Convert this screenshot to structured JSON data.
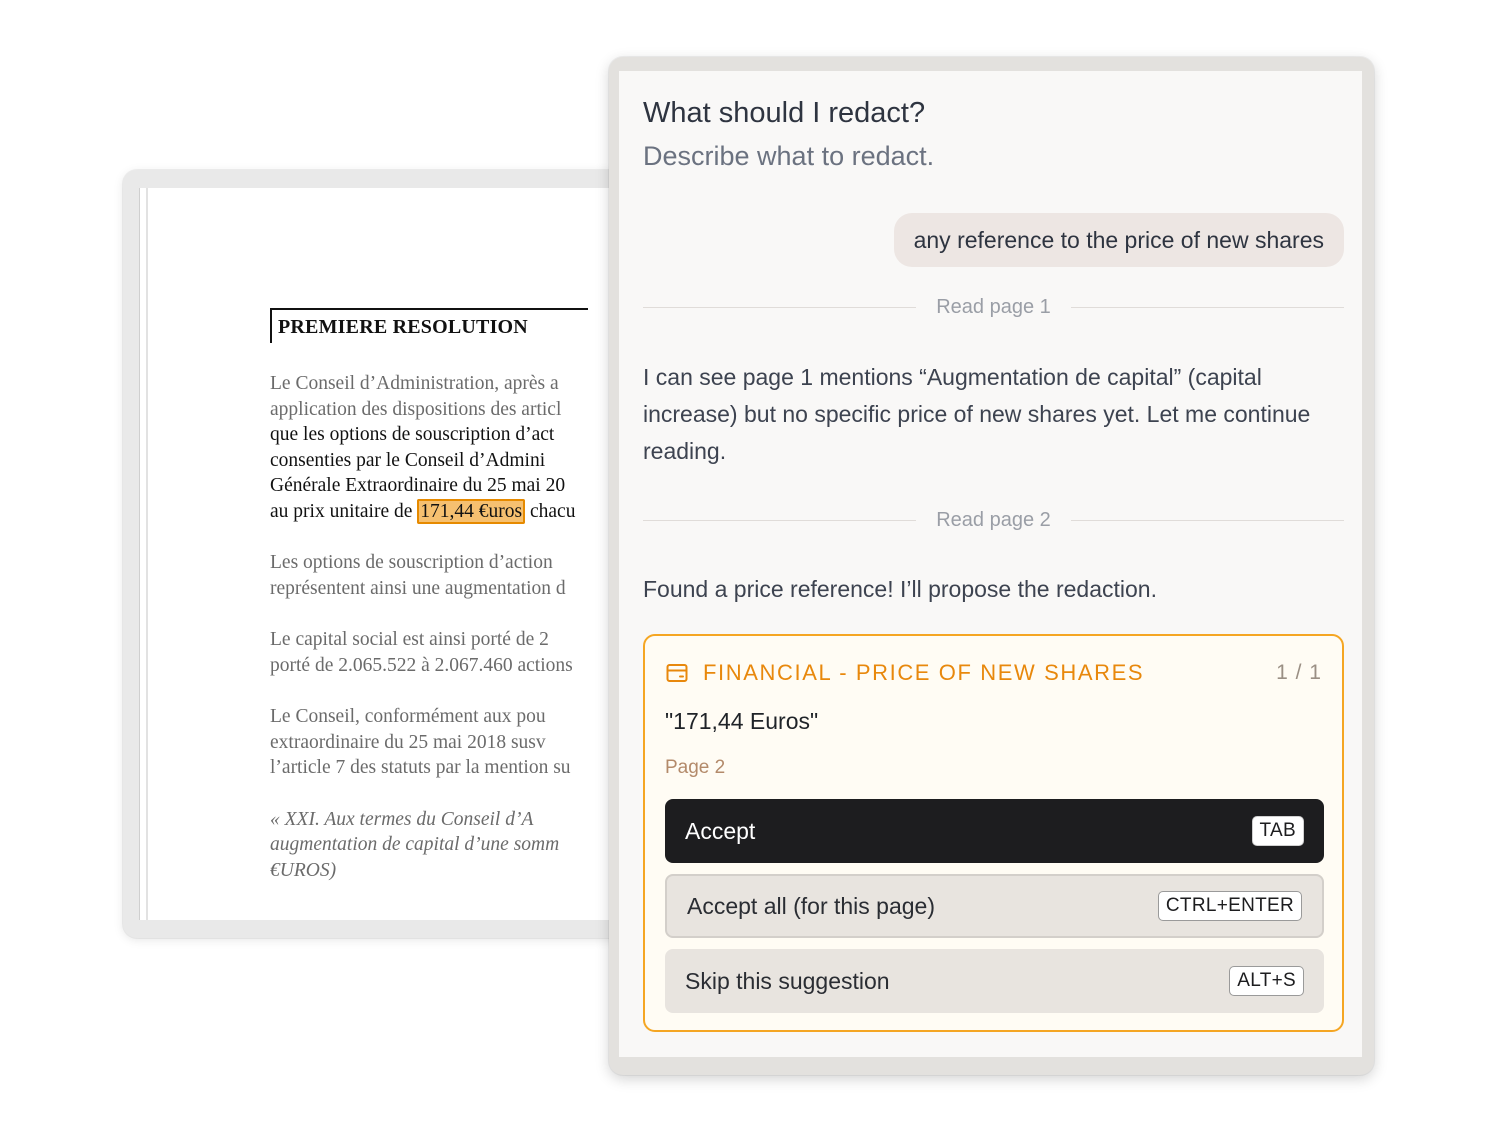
{
  "document": {
    "heading": "PREMIERE RESOLUTION",
    "paragraphs": [
      {
        "lines": [
          "Le Conseil d’Administration, après a",
          "application des dispositions des articl",
          "que les options de souscription d’act",
          "consenties par le Conseil d’Admini",
          "Générale Extraordinaire du 25 mai 20"
        ],
        "last_line_before": "au prix unitaire de ",
        "highlight": "171,44 €uros",
        "last_line_after": " chacu"
      },
      {
        "lines": [
          "Les options de souscription d’action",
          "représentent ainsi une augmentation d"
        ]
      },
      {
        "lines": [
          "Le capital social est ainsi porté de 2",
          "porté de 2.065.522 à 2.067.460 actions"
        ]
      },
      {
        "lines": [
          "Le Conseil, conformément aux pou",
          "extraordinaire du 25 mai 2018 susv",
          "l’article 7 des statuts par la mention su"
        ]
      },
      {
        "lines": [
          "« XXI. Aux termes du Conseil d’A",
          "augmentation de capital d’une somm",
          "€UROS)"
        ]
      }
    ]
  },
  "panel": {
    "title": "What should I redact?",
    "subtitle": "Describe what to redact.",
    "user_message": "any reference to the price of new shares",
    "divider_1": "Read page 1",
    "assistant_message_1": "I can see page 1 mentions “Augmentation de capital” (capital increase) but no specific price of new shares yet. Let me continue reading.",
    "divider_2": "Read page 2",
    "assistant_message_2": "Found a price reference! I’ll propose the redaction.",
    "suggestion": {
      "icon": "credit-card-icon",
      "category": "FINANCIAL - PRICE OF NEW SHARES",
      "counter": "1 / 1",
      "quote": "\"171,44 Euros\"",
      "page": "Page 2",
      "accept_label": "Accept",
      "accept_shortcut": "TAB",
      "accept_all_label": "Accept all (for this page)",
      "accept_all_shortcut": "CTRL+ENTER",
      "skip_label": "Skip this suggestion",
      "skip_shortcut": "ALT+S"
    }
  },
  "colors": {
    "accent_orange": "#f5a623",
    "highlight_fill": "#f6c070",
    "accept_button": "#1d1d1f"
  }
}
